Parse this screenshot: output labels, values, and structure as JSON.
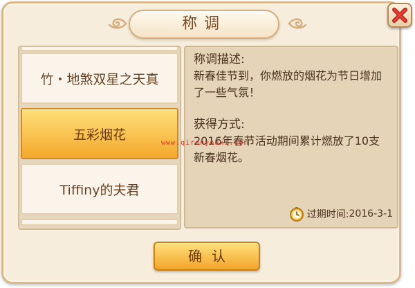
{
  "dialog": {
    "title": "称调",
    "close_icon": "close-icon",
    "confirm_label": "确认"
  },
  "title_list": {
    "items": [
      {
        "label": "竹・地煞双星之天真",
        "selected": false
      },
      {
        "label": "五彩烟花",
        "selected": true
      },
      {
        "label": "Tiffiny的夫君",
        "selected": false
      }
    ]
  },
  "detail": {
    "desc_heading": "称调描述:",
    "desc_text": "新春佳节到，你燃放的烟花为节日增加了一些气氛！",
    "obtain_heading": "获得方式:",
    "obtain_text": "2016年春节活动期间累计燃放了10支新春烟花。",
    "expire_label": "过期时间:",
    "expire_value": "2016-3-1",
    "expire_icon": "clock-icon"
  },
  "watermark": "www.qirenyouxi.com",
  "colors": {
    "accent": "#f4a82c",
    "panel": "#f6eddc",
    "close": "#c0201a"
  }
}
